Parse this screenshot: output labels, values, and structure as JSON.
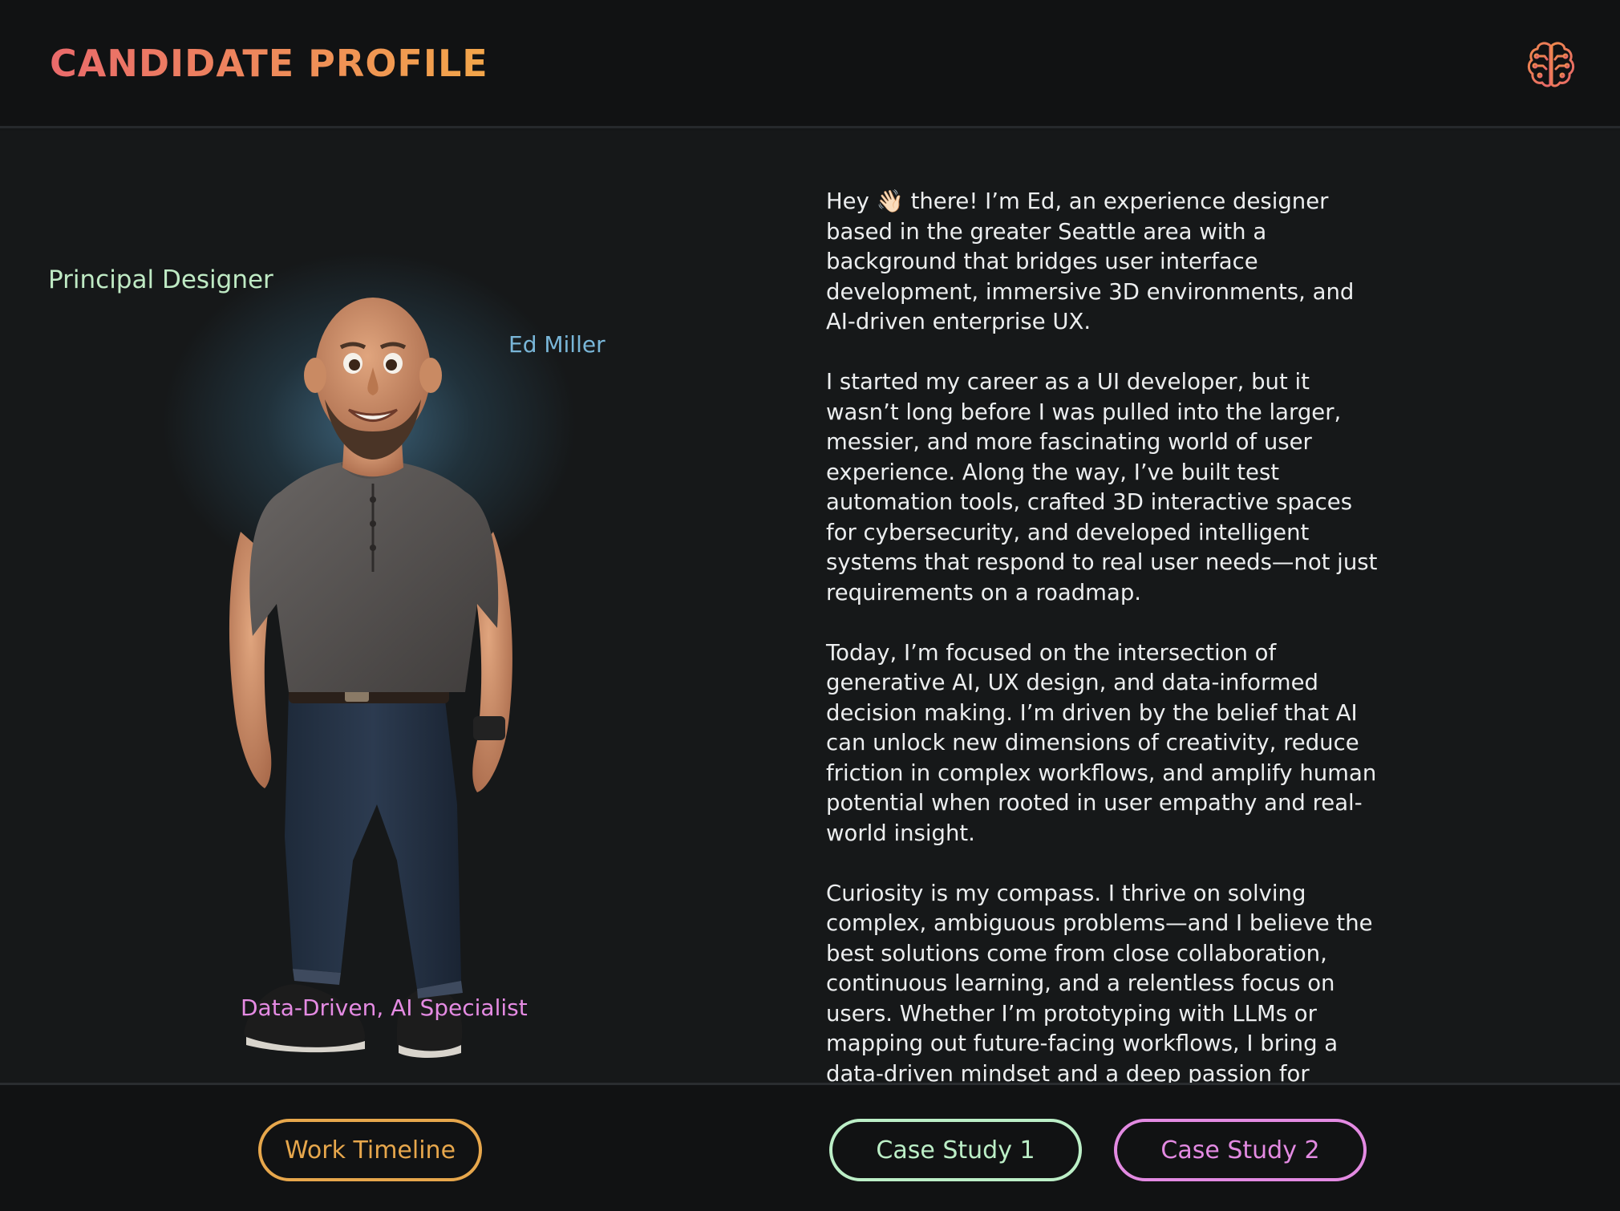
{
  "header": {
    "title": "CANDIDATE PROFILE",
    "icon": "brain-icon",
    "title_gradient": [
      "#ea6a6b",
      "#f3a64a"
    ]
  },
  "profile": {
    "role": "Principal Designer",
    "name": "Ed Miller",
    "specialty": "Data-Driven, AI Specialist",
    "colors": {
      "role": "#bfeac4",
      "name": "#79b6d8",
      "specialty": "#e58be3"
    }
  },
  "bio": {
    "paragraphs": [
      "Hey 👋🏻 there! I’m Ed, an experience designer based in the greater Seattle area with a background that bridges user interface development, immersive 3D environments, and AI-driven enterprise UX.",
      "I started my career as a UI developer, but it wasn’t long before I was pulled into the larger, messier, and more fascinating world of user experience. Along the way, I’ve built test automation tools, crafted 3D interactive spaces for cybersecurity, and developed intelligent systems that respond to real user needs—not just requirements on a roadmap.",
      "Today, I’m focused on the intersection of generative AI, UX design, and data-informed decision making. I’m driven by the belief that AI can unlock new dimensions of creativity, reduce friction in complex workflows, and amplify human potential when rooted in user empathy and real-world insight.",
      "Curiosity is my compass. I thrive on solving complex, ambiguous problems—and I believe the best solutions come from close collaboration, continuous learning, and a relentless focus on users. Whether I’m prototyping with LLMs or mapping out future-facing workflows, I bring a data-driven mindset and a deep passion for advancing what’s possible through user-centered AI design."
    ]
  },
  "footer": {
    "buttons": {
      "timeline": "Work Timeline",
      "case_study_1": "Case Study 1",
      "case_study_2": "Case Study 2"
    },
    "colors": {
      "timeline": "#e7a74c",
      "case_study_1": "#bcefc7",
      "case_study_2": "#e38ae2"
    }
  }
}
